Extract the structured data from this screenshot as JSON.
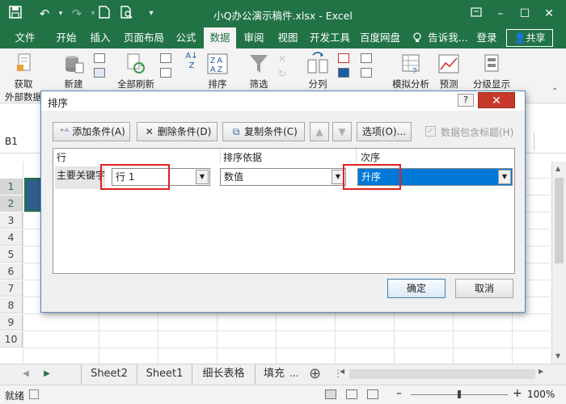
{
  "window": {
    "title": "小Q办公演示稿件.xlsx - Excel",
    "accent": "#217346"
  },
  "menu": {
    "tabs": [
      "文件",
      "开始",
      "插入",
      "页面布局",
      "公式",
      "数据",
      "审阅",
      "视图",
      "开发工具",
      "百度网盘"
    ],
    "active_tab": "数据",
    "tell_me": "告诉我...",
    "login": "登录",
    "share": "共享"
  },
  "ribbon": {
    "get_external_data": [
      "获取",
      "外部数据"
    ],
    "new_query": "新建",
    "refresh_all": "全部刷新",
    "sort": "排序",
    "filter": "筛选",
    "split": "分列",
    "what_if": "模拟分析",
    "forecast": "预测",
    "outline": "分级显示"
  },
  "formula_bar": {
    "name_box": "B1"
  },
  "grid": {
    "row_numbers": [
      "1",
      "2",
      "3",
      "4",
      "5",
      "6",
      "7",
      "8",
      "9",
      "10"
    ]
  },
  "sheet_tabs": {
    "tabs": [
      "Sheet2",
      "Sheet1",
      "细长表格",
      "填充"
    ],
    "more": "...",
    "add": "⊕"
  },
  "status": {
    "ready": "就绪",
    "zoom": "100%"
  },
  "sort_dialog": {
    "title": "排序",
    "help": "?",
    "close": "✕",
    "add_level": "添加条件(A)",
    "delete_level": "删除条件(D)",
    "copy_level": "复制条件(C)",
    "options": "选项(O)...",
    "has_headers": "数据包含标题(H)",
    "columns": {
      "row": "行",
      "sort_on": "排序依据",
      "order": "次序"
    },
    "rows": [
      {
        "label": "主要关键字",
        "key": "行 1",
        "sort_on": "数值",
        "order": "升序"
      }
    ],
    "ok": "确定",
    "cancel": "取消"
  }
}
